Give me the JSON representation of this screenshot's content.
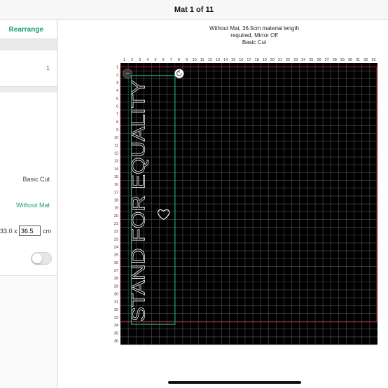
{
  "header": {
    "title": "Mat 1 of 11"
  },
  "left_panel": {
    "rearrange_label": "Rearrange",
    "copies_value": "1",
    "cut_type": "Basic Cut",
    "mat_option": "Without Mat",
    "size_width": "33.0 x",
    "size_length_value": "36.5",
    "size_unit": "cm",
    "mirror_on": false
  },
  "mat_info": {
    "line1": "Without Mat, 36.5cm material length",
    "line2": "required, Mirror Off",
    "line3": "Basic Cut"
  },
  "mat": {
    "columns": [
      "1",
      "2",
      "3",
      "4",
      "5",
      "6",
      "7",
      "8",
      "9",
      "10",
      "11",
      "12",
      "13",
      "14",
      "15",
      "16",
      "17",
      "18",
      "19",
      "20",
      "21",
      "22",
      "23",
      "24",
      "25",
      "26",
      "27",
      "28",
      "29",
      "30",
      "31",
      "32",
      "33"
    ],
    "rows": [
      "1",
      "2",
      "3",
      "4",
      "5",
      "6",
      "7",
      "8",
      "9",
      "10",
      "11",
      "12",
      "13",
      "14",
      "15",
      "16",
      "17",
      "18",
      "19",
      "20",
      "21",
      "22",
      "23",
      "24",
      "25",
      "26",
      "27",
      "28",
      "29",
      "30",
      "31",
      "32",
      "33",
      "34",
      "35",
      "36"
    ],
    "design_text": "STAND FOR EQUALITY",
    "more_icon": "ellipsis-icon",
    "rotate_icon": "rotate-icon",
    "heart_icon": "heart-icon",
    "selection_color": "#19a476",
    "material_outline_color": "#b3202a",
    "mat_color": "#000000",
    "grid_color": "#555555"
  }
}
